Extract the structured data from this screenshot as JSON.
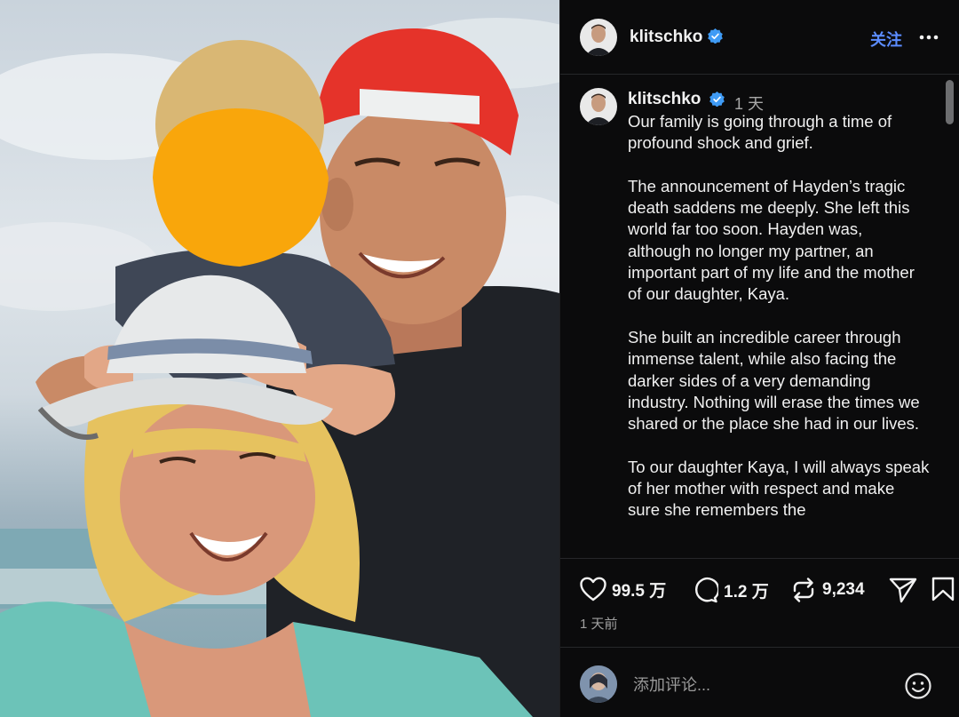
{
  "colors": {
    "accent": "#5b8cff",
    "panel_bg": "#0b0b0c",
    "verified_blue": "#3f9bf5",
    "face_blur": "#f9a60b"
  },
  "header": {
    "username": "klitschko",
    "follow_label": "关注",
    "more_icon": "ellipsis-icon",
    "verified_icon": "verified-badge-icon"
  },
  "caption": {
    "username": "klitschko",
    "time": "1 天",
    "paragraphs": [
      "Our family is going through a time of profound shock and grief.",
      "The announcement of Hayden’s tragic death saddens me deeply. She left this world far too soon. Hayden was, although no longer my partner, an important part of my life and the mother of our daughter, Kaya.",
      "She built an incredible career through immense talent, while also facing the darker sides of a very demanding industry. Nothing will erase the times we shared or the place she had in our lives.",
      "To our daughter Kaya, I will always speak of her mother with respect and make sure she remembers the"
    ]
  },
  "actions": {
    "likes": "99.5 万",
    "comments": "1.2 万",
    "reposts": "9,234",
    "like_icon": "heart-icon",
    "comment_icon": "comment-bubble-icon",
    "repost_icon": "repost-icon",
    "share_icon": "send-icon",
    "save_icon": "bookmark-icon",
    "time_ago": "1 天前"
  },
  "comment_box": {
    "placeholder": "添加评论...",
    "emoji_icon": "smiley-icon"
  }
}
